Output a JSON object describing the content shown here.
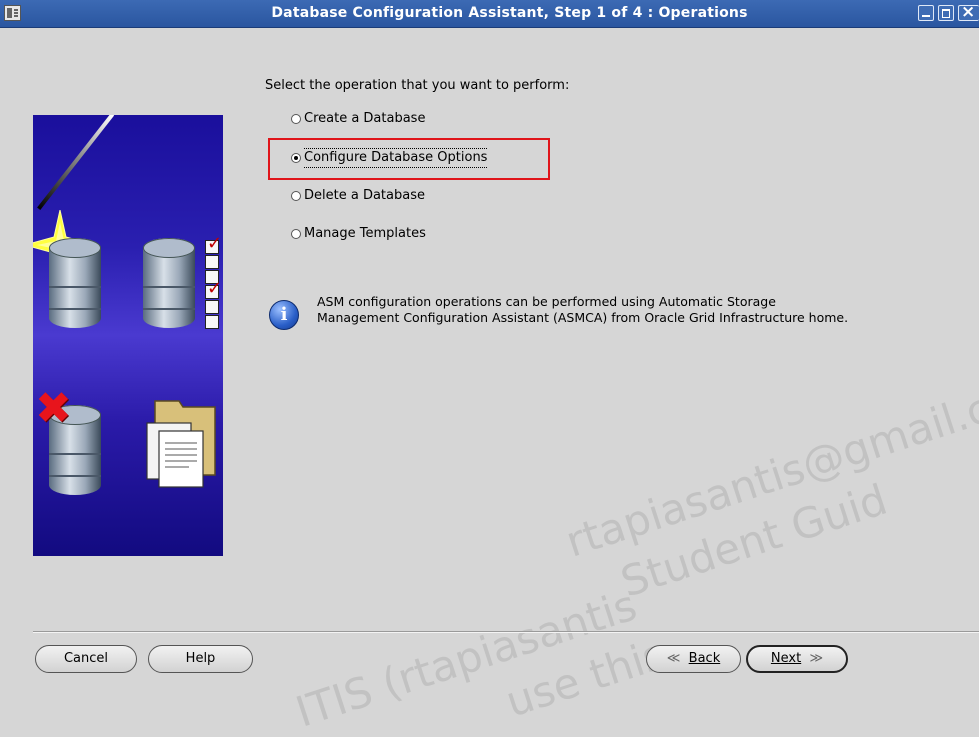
{
  "window": {
    "title": "Database Configuration Assistant, Step 1 of 4 : Operations"
  },
  "prompt": "Select the operation that you want to perform:",
  "options": [
    {
      "label": "Create a Database",
      "selected": false
    },
    {
      "label": "Configure Database Options",
      "selected": true
    },
    {
      "label": "Delete a Database",
      "selected": false
    },
    {
      "label": "Manage Templates",
      "selected": false
    }
  ],
  "info": {
    "icon": "info-icon",
    "line1": "ASM configuration operations can be performed using Automatic Storage",
    "line2": "Management Configuration Assistant (ASMCA) from Oracle Grid Infrastructure home."
  },
  "watermark": {
    "line1": "rtapiasantis@gmail.com)",
    "line2": "Student Guid",
    "line3": "ITIS (rtapiasantis",
    "line4": "use this"
  },
  "buttons": {
    "cancel": "Cancel",
    "help": "Help",
    "back": "Back",
    "next": "Next"
  },
  "colors": {
    "titlebar": "#2a56a0",
    "highlight_box": "#e0141a",
    "background": "#d6d6d6"
  }
}
